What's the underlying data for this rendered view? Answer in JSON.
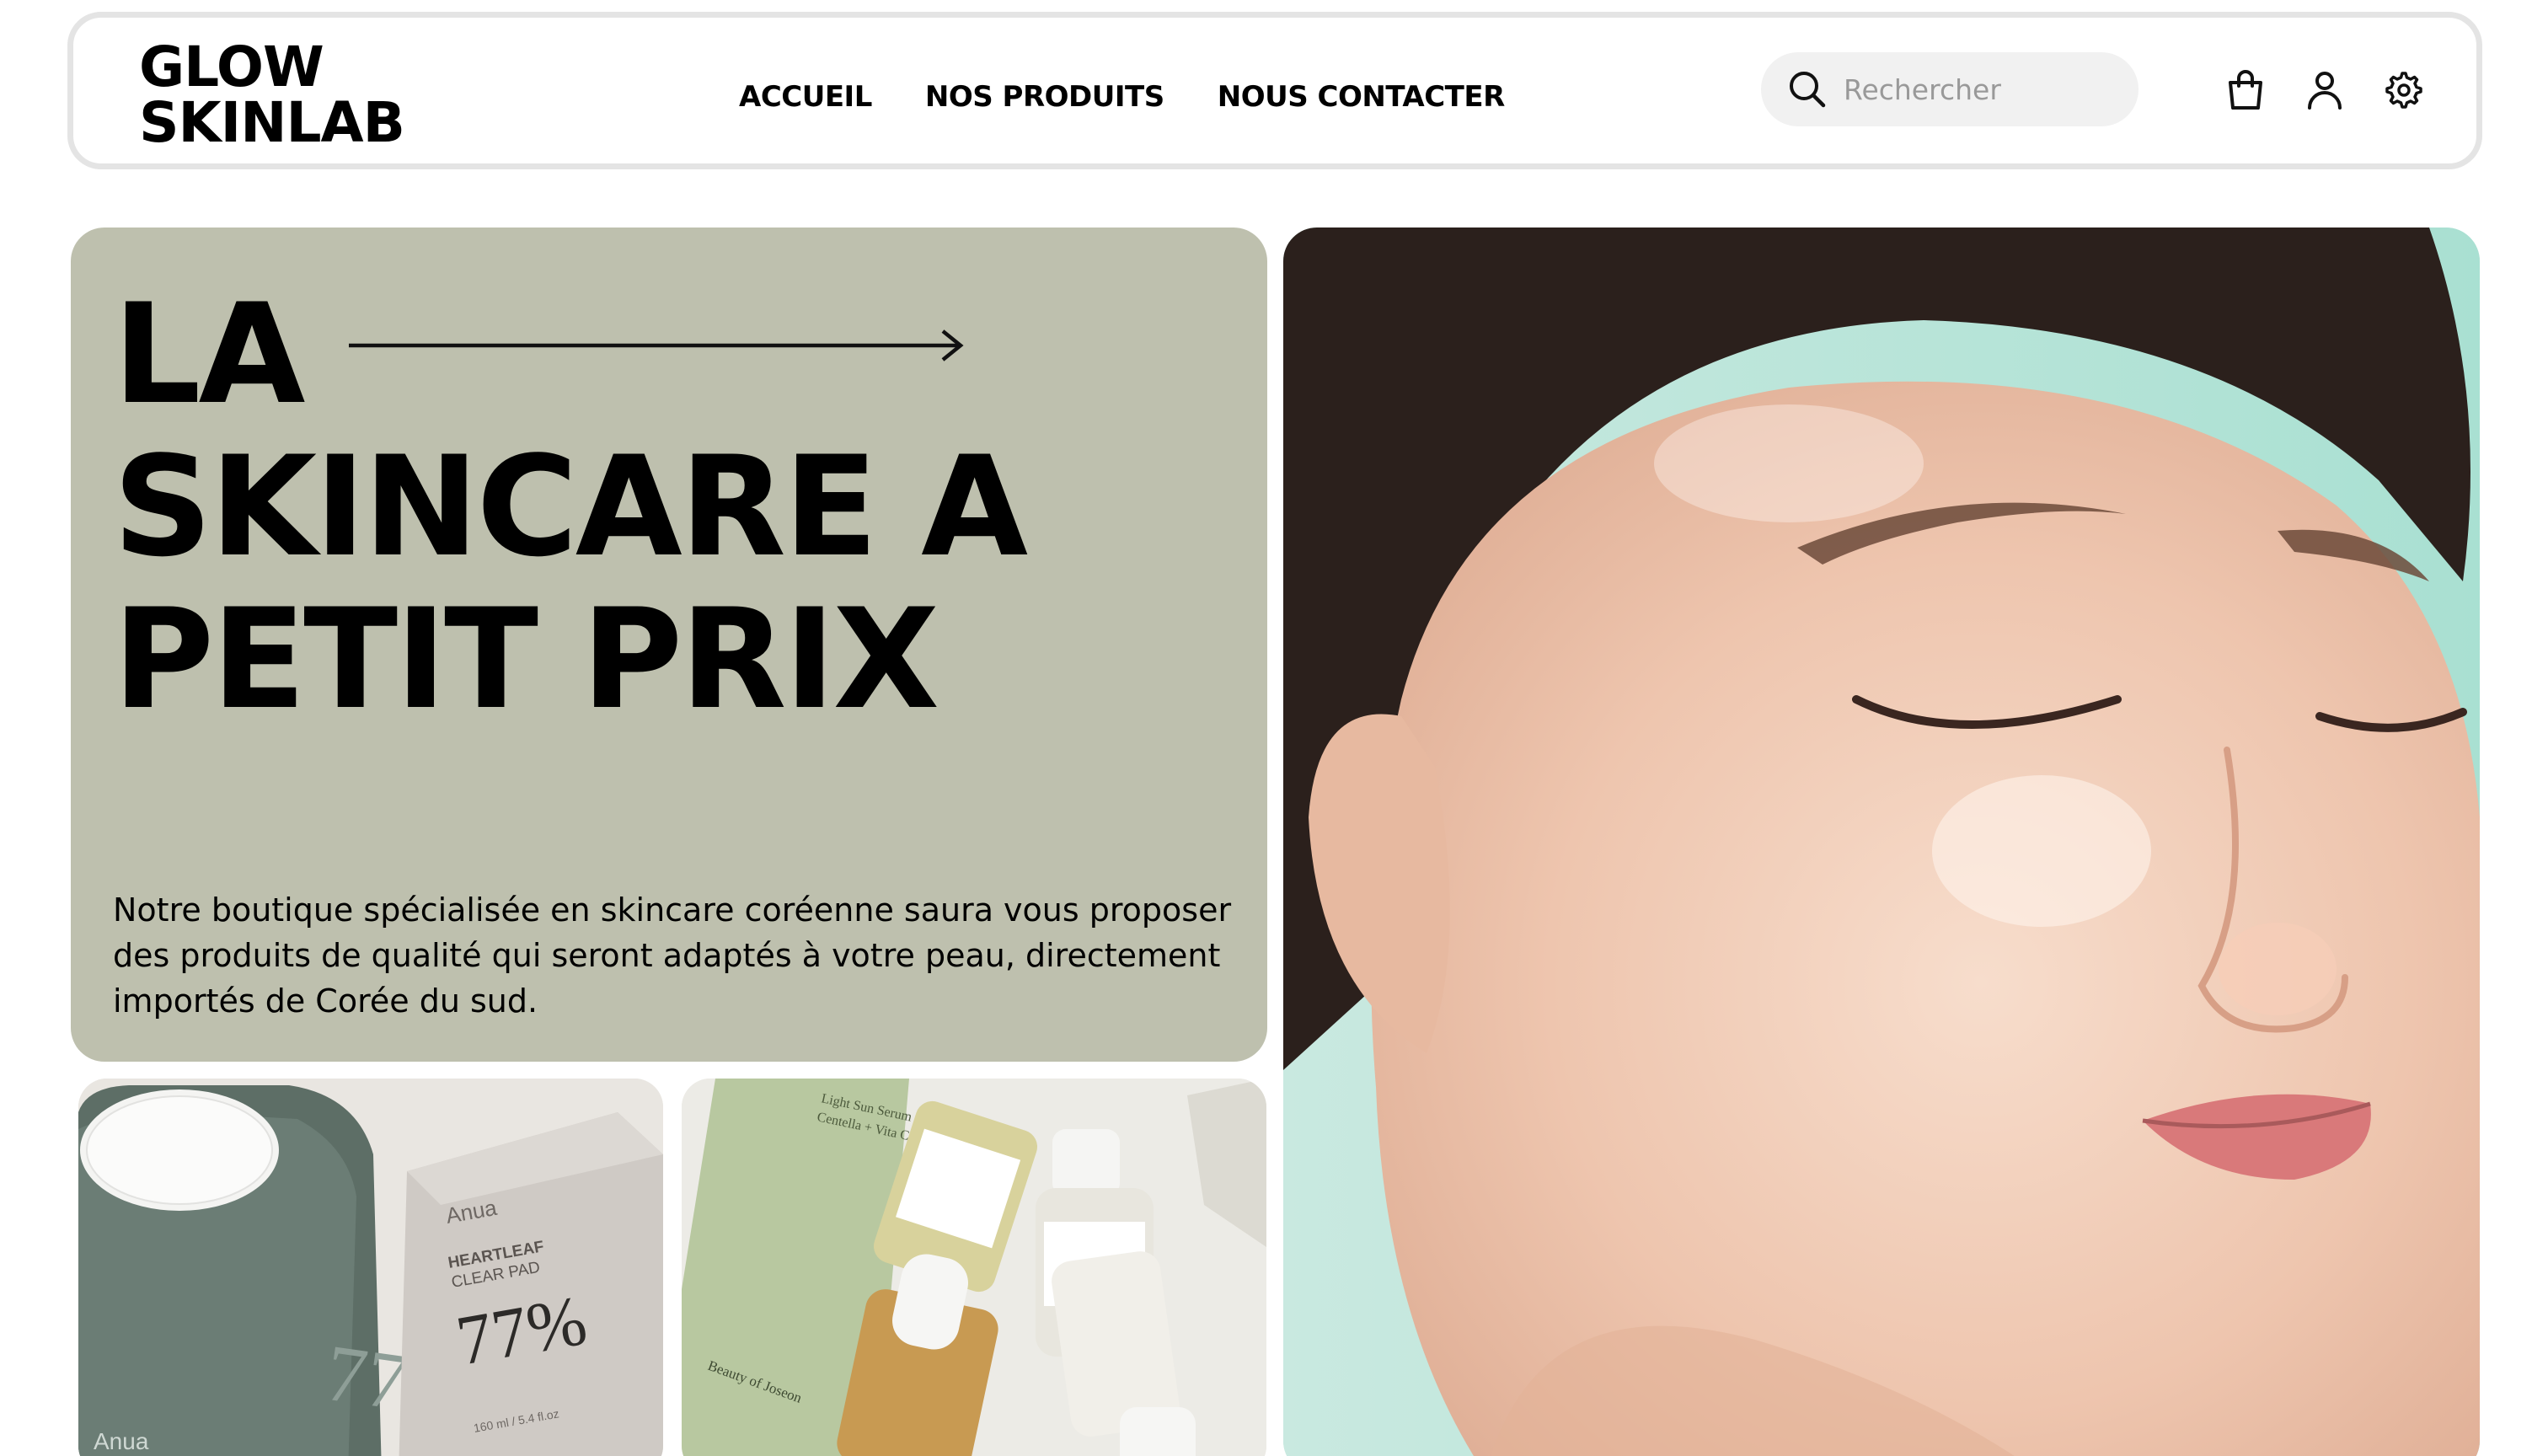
{
  "brand": {
    "line1": "GLOW",
    "line2": "SKINLAB"
  },
  "nav": {
    "items": [
      {
        "label": "ACCUEIL"
      },
      {
        "label": "NOS PRODUITS"
      },
      {
        "label": "NOUS CONTACTER"
      }
    ]
  },
  "search": {
    "placeholder": "Rechercher",
    "value": ""
  },
  "header_icons": [
    "search-icon",
    "shopping-bag-icon",
    "user-icon",
    "settings-gear-icon"
  ],
  "hero": {
    "title_line1": "LA",
    "title_line2": "SKINCARE A",
    "title_line3": "PETIT PRIX",
    "description_line1": "Notre boutique spécialisée en skincare coréenne saura vous proposer",
    "description_line2": "des produits de qualité qui seront adaptés à votre peau, directement",
    "description_line3": "importés de Corée du sud."
  },
  "products": {
    "left": {
      "brand_box": "Anua",
      "product_line1": "HEARTLEAF",
      "product_line2": "CLEAR PAD",
      "percent": "77%",
      "volume": "160 ml / 5.4 fl.oz",
      "jar_brand": "Anua",
      "jar_mark": "77"
    },
    "right": {
      "tube_line1": "Light Sun Serum",
      "tube_line2": "Centella + Vita C",
      "tube_brand": "Beauty of Joseon"
    }
  },
  "colors": {
    "hero_bg": "#bec0ae",
    "header_border": "#e4e4e4",
    "search_bg": "#f1f1f1",
    "portrait_bg": "#bde6dc"
  }
}
